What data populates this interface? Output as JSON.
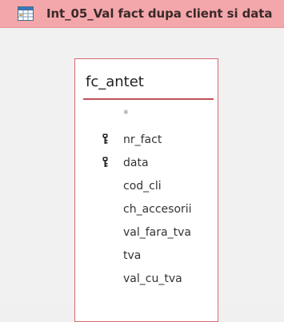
{
  "tab": {
    "title": "Int_05_Val fact dupa client si data",
    "icon": "query-table-icon",
    "background": "#f4a7aa"
  },
  "field_list": {
    "title": "fc_antet",
    "border_color": "#d66b72",
    "fields": [
      {
        "name": "*",
        "is_key": false
      },
      {
        "name": "nr_fact",
        "is_key": true
      },
      {
        "name": "data",
        "is_key": true
      },
      {
        "name": "cod_cli",
        "is_key": false
      },
      {
        "name": "ch_accesorii",
        "is_key": false
      },
      {
        "name": "val_fara_tva",
        "is_key": false
      },
      {
        "name": "tva",
        "is_key": false
      },
      {
        "name": "val_cu_tva",
        "is_key": false
      }
    ]
  }
}
